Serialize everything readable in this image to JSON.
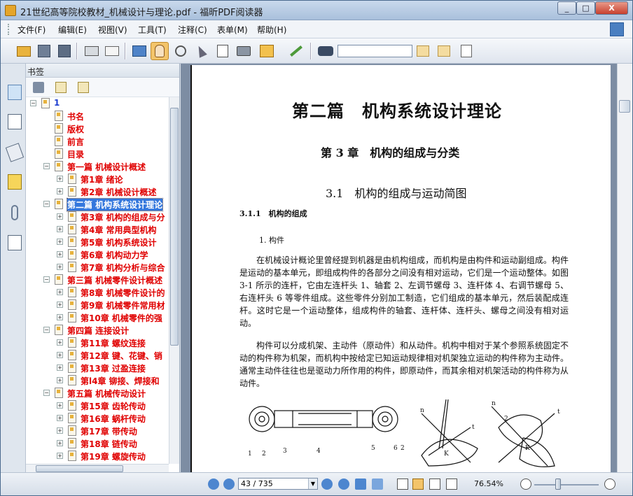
{
  "window": {
    "title": "21世纪高等院校教材_机械设计与理论.pdf - 福昕PDF阅读器",
    "btn_min": "_",
    "btn_max": "□",
    "btn_close": "X"
  },
  "menu": [
    "文件(F)",
    "编辑(E)",
    "视图(V)",
    "工具(T)",
    "注释(C)",
    "表单(M)",
    "帮助(H)"
  ],
  "toolbar": {
    "icons": [
      "open-icon",
      "save-icon",
      "save-as-icon",
      "print-icon",
      "email-icon",
      "screen-icon",
      "hand-icon",
      "zoom-icon",
      "select-icon",
      "text-select-icon",
      "snapshot-icon",
      "rms-icon",
      "sign-icon",
      "binoculars-icon"
    ],
    "search_value": ""
  },
  "bookmarks": {
    "header": "书签",
    "items": [
      {
        "label": "1",
        "level": 0,
        "expanded": true
      },
      {
        "label": "书名",
        "level": 1
      },
      {
        "label": "版权",
        "level": 1
      },
      {
        "label": "前言",
        "level": 1
      },
      {
        "label": "目录",
        "level": 1
      },
      {
        "label": "第一篇 机械设计概述",
        "level": 1,
        "expanded": true
      },
      {
        "label": "第1章 绪论",
        "level": 2,
        "collapsed": true
      },
      {
        "label": "第2章 机械设计概述",
        "level": 2,
        "collapsed": true
      },
      {
        "label": "第二篇 机构系统设计理论",
        "level": 1,
        "expanded": true,
        "selected": true
      },
      {
        "label": "第3章 机构的组成与分",
        "level": 2,
        "collapsed": true
      },
      {
        "label": "第4章 常用典型机构",
        "level": 2,
        "collapsed": true
      },
      {
        "label": "第5章 机构系统设计",
        "level": 2,
        "collapsed": true
      },
      {
        "label": "第6章 机构动力学",
        "level": 2,
        "collapsed": true
      },
      {
        "label": "第7章 机构分析与综合",
        "level": 2,
        "collapsed": true
      },
      {
        "label": "第三篇 机械零件设计概述",
        "level": 1,
        "expanded": true
      },
      {
        "label": "第8章 机械零件设计的",
        "level": 2,
        "collapsed": true
      },
      {
        "label": "第9章 机械零件常用材",
        "level": 2,
        "collapsed": true
      },
      {
        "label": "第10章 机械零件的强",
        "level": 2,
        "collapsed": true
      },
      {
        "label": "第四篇 连接设计",
        "level": 1,
        "expanded": true
      },
      {
        "label": "第11章 螺纹连接",
        "level": 2,
        "collapsed": true
      },
      {
        "label": "第12章 键、花键、销",
        "level": 2,
        "collapsed": true
      },
      {
        "label": "第13章 过盈连接",
        "level": 2,
        "collapsed": true
      },
      {
        "label": "第l4章 铆接、焊接和",
        "level": 2,
        "collapsed": true
      },
      {
        "label": "第五篇 机械传动设计",
        "level": 1,
        "expanded": true
      },
      {
        "label": "第15章 齿轮传动",
        "level": 2,
        "collapsed": true
      },
      {
        "label": "第16章 蜗杆传动",
        "level": 2,
        "collapsed": true
      },
      {
        "label": "第17章 带传动",
        "level": 2,
        "collapsed": true
      },
      {
        "label": "第18章 链传动",
        "level": 2,
        "collapsed": true
      },
      {
        "label": "第19章 螺旋传动",
        "level": 2,
        "collapsed": true
      }
    ]
  },
  "page": {
    "part_title": "第二篇　机构系统设计理论",
    "chapter_title": "第 3 章　机构的组成与分类",
    "section_title": "3.1　机构的组成与运动简图",
    "sub_title": "3.1.1　机构的组成",
    "item_title": "1. 构件",
    "para1": "在机械设计概论里曾经提到机器是由机构组成，而机构是由构件和运动副组成。构件是运动的基本单元，即组成构件的各部分之间没有相对运动，它们是一个运动整体。如图 3-1 所示的连杆，它由左连杆头 1、轴套 2、左调节螺母 3、连杆体 4、右调节螺母 5、右连杆头 6 等零件组成。这些零件分别加工制造，它们组成的基本单元，然后装配成连杆。这时它是一个运动整体，组成构件的轴套、连杆体、连杆头、螺母之间没有相对运动。",
    "para2": "构件可以分成机架、主动件（原动件）和从动件。机构中相对于某个参照系统固定不动的构件称为机架，而机构中按给定已知运动规律相对机架独立运动的构件称为主动件。通常主动件往往也是驱动力所作用的构件，即原动件，而其余相对机架活动的构件称为从动件。",
    "fig_labels": [
      "1",
      "2",
      "3",
      "4",
      "5",
      "6",
      "2",
      "n",
      "t",
      "K",
      "n",
      "2",
      "t",
      "K"
    ]
  },
  "status": {
    "page_value": "43 / 735",
    "zoom": "76.54%"
  }
}
